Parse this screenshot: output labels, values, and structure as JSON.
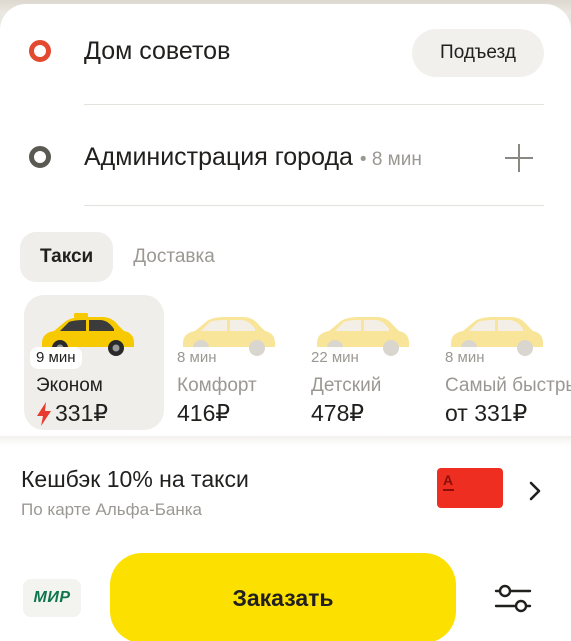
{
  "route": {
    "from": {
      "address": "Дом советов",
      "entrance_label": "Подъезд"
    },
    "to": {
      "address": "Администрация города",
      "eta": "• 8 мин"
    }
  },
  "service_tabs": [
    {
      "label": "Такси",
      "active": true
    },
    {
      "label": "Доставка",
      "active": false
    }
  ],
  "tariffs": [
    {
      "eta": "9 мин",
      "name": "Эконом",
      "price": "331₽",
      "selected": true,
      "surge": true
    },
    {
      "eta": "8 мин",
      "name": "Комфорт",
      "price": "416₽",
      "selected": false
    },
    {
      "eta": "22 мин",
      "name": "Детский",
      "price": "478₽",
      "selected": false
    },
    {
      "eta": "8 мин",
      "name": "Самый быстрый",
      "price": "от 331₽",
      "selected": false
    }
  ],
  "cashback": {
    "title": "Кешбэк 10% на такси",
    "subtitle": "По карте Альфа-Банка",
    "card_logo": "А"
  },
  "payment": {
    "method_label": "МИР"
  },
  "order_button": {
    "label": "Заказать"
  },
  "icons": {
    "origin": "origin-dot-icon",
    "destination": "destination-dot-icon",
    "add_stop": "plus-icon",
    "surge": "bolt-icon",
    "more": "chevron-right-icon",
    "options": "settings-sliders-icon"
  },
  "colors": {
    "accent_yellow": "#fce000",
    "origin_red": "#e2492f",
    "surge_red": "#e83a2f",
    "alfa_red": "#ef2e22",
    "mir_green": "#0f754e",
    "muted_text": "#9b9893"
  }
}
